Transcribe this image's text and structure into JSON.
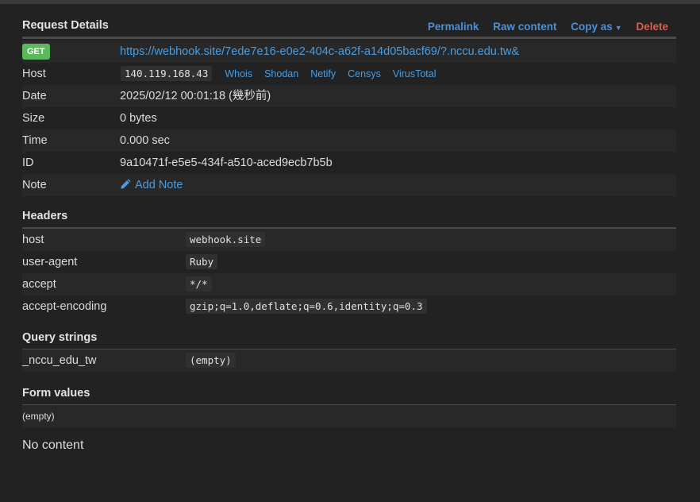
{
  "request": {
    "title": "Request Details",
    "actions": {
      "permalink": "Permalink",
      "raw": "Raw content",
      "copy_as": "Copy as",
      "delete": "Delete"
    },
    "method": "GET",
    "url": "https://webhook.site/7ede7e16-e0e2-404c-a62f-a14d05bacf69/?.nccu.edu.tw&",
    "host_label": "Host",
    "host_ip": "140.119.168.43",
    "host_links": [
      "Whois",
      "Shodan",
      "Netify",
      "Censys",
      "VirusTotal"
    ],
    "date_label": "Date",
    "date": "2025/02/12 00:01:18 (幾秒前)",
    "size_label": "Size",
    "size": "0 bytes",
    "time_label": "Time",
    "time": "0.000 sec",
    "id_label": "ID",
    "id": "9a10471f-e5e5-434f-a510-aced9ecb7b5b",
    "note_label": "Note",
    "add_note": "Add Note"
  },
  "headers": {
    "title": "Headers",
    "rows": [
      {
        "key": "host",
        "value": "webhook.site"
      },
      {
        "key": "user-agent",
        "value": "Ruby"
      },
      {
        "key": "accept",
        "value": "*/*"
      },
      {
        "key": "accept-encoding",
        "value": "gzip;q=1.0,deflate;q=0.6,identity;q=0.3"
      }
    ]
  },
  "query": {
    "title": "Query strings",
    "rows": [
      {
        "key": "_nccu_edu_tw",
        "value": "(empty)"
      }
    ]
  },
  "form": {
    "title": "Form values",
    "empty": "(empty)"
  },
  "body_text": "No content",
  "colors": {
    "link": "#4a9de0",
    "delete": "#e05b4c",
    "get_badge": "#5cb85c",
    "background": "#222222"
  },
  "icons": {
    "add_note": "pencil-icon",
    "copy_as": "caret-down-icon"
  }
}
